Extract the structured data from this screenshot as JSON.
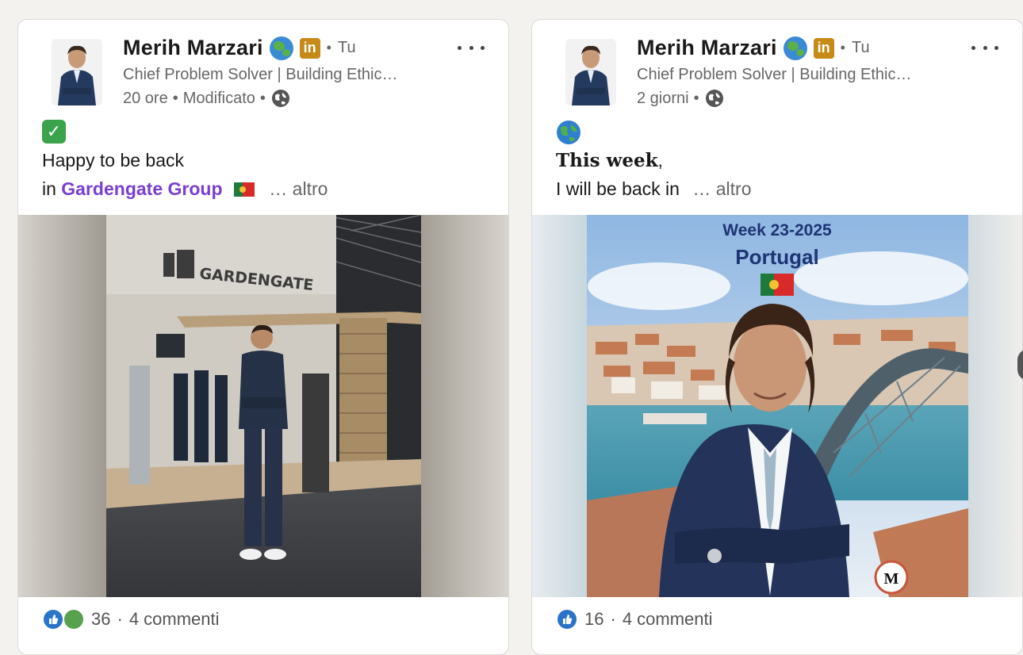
{
  "posts": [
    {
      "author": "Merih Marzari",
      "connection": "Tu",
      "headline": "Chief Problem Solver | Building Ethic…",
      "time": "20 ore",
      "edited": "Modificato",
      "text_line1": "Happy to be back",
      "text_in": "in",
      "mention": "Gardengate Group",
      "more": "… altro",
      "image_brand": "GARDENGATE",
      "reactions_count": "36",
      "comments": "4 commenti",
      "icons": [
        "world-globe-icon",
        "linkedin-premium-icon",
        "public-globe-icon",
        "more-options-icon",
        "check-mark-emoji",
        "portugal-flag-emoji",
        "like-reaction-icon",
        "celebrate-reaction-icon"
      ]
    },
    {
      "author": "Merih Marzari",
      "connection": "Tu",
      "headline": "Chief Problem Solver | Building Ethic…",
      "time": "2 giorni",
      "text_bold": "This week",
      "text_comma": ",",
      "text_line2": "I will be back in",
      "more": "… altro",
      "image_title1": "Week 23-2025",
      "image_title2": "Portugal",
      "image_logo": "M",
      "reactions_count": "16",
      "comments": "4 commenti",
      "icons": [
        "world-globe-icon",
        "linkedin-premium-icon",
        "public-globe-icon",
        "more-options-icon",
        "globe-emoji",
        "like-reaction-icon"
      ]
    }
  ],
  "colors": {
    "mention": "#7a3fd0",
    "meta_gray": "#666666",
    "premium_gold": "#c68a18",
    "like_blue": "#2b73c9",
    "page_bg": "#f4f2ee"
  }
}
